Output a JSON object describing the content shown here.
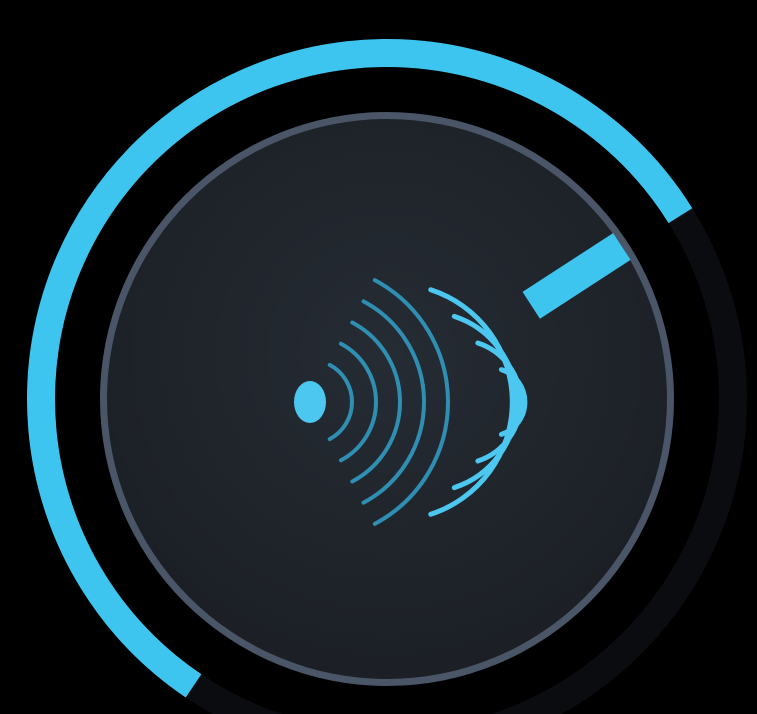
{
  "knob": {
    "name": "echo-amount-knob",
    "value_fraction": 0.68,
    "colors": {
      "background": "#000000",
      "track": "#0a0c0f",
      "accent": "#3dc5f0",
      "knob_face": "#20252c",
      "knob_rim": "#4a5668",
      "icon_primary": "#4cc7ef",
      "icon_secondary": "#2f8fb3"
    }
  },
  "icon": {
    "name": "echo-wave-icon"
  }
}
